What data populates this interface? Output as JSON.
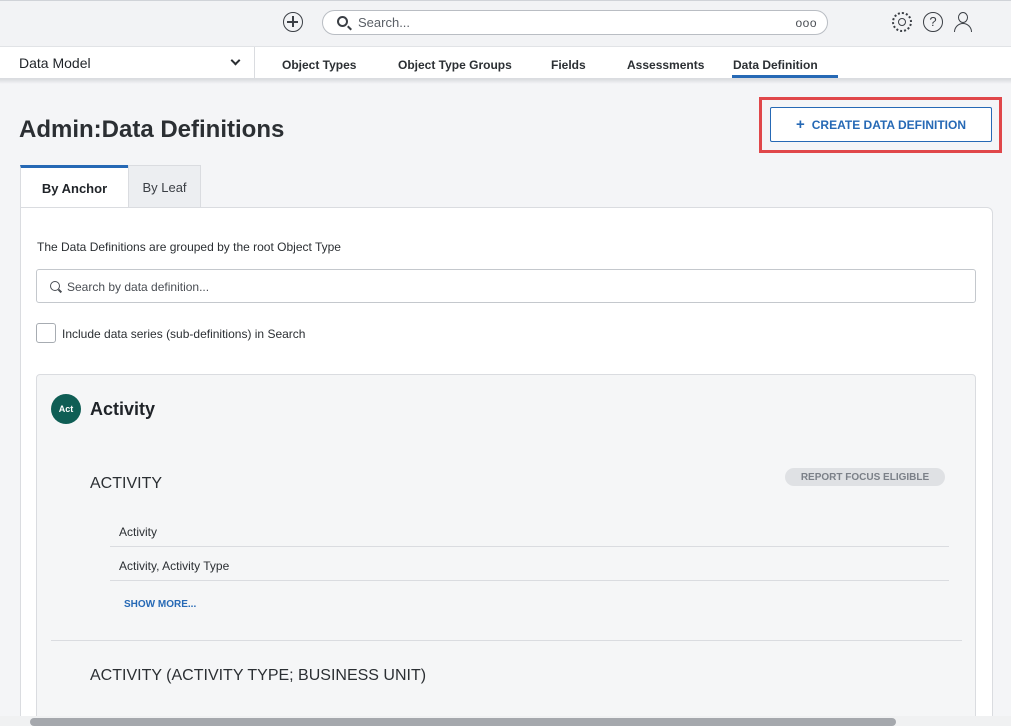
{
  "topbar": {
    "search_placeholder": "Search...",
    "search_options": "ooo",
    "help_glyph": "?",
    "icons": [
      "add-circle-icon",
      "search-icon",
      "settings-icon",
      "help-icon",
      "user-icon"
    ]
  },
  "nav": {
    "module": "Data Model",
    "tabs": [
      {
        "label": "Object Types",
        "active": false
      },
      {
        "label": "Object Type Groups",
        "active": false
      },
      {
        "label": "Fields",
        "active": false
      },
      {
        "label": "Assessments",
        "active": false
      },
      {
        "label": "Data Definition",
        "active": true
      }
    ]
  },
  "page": {
    "title": "Admin:Data Definitions",
    "create_button": "CREATE DATA DEFINITION",
    "create_plus": "+"
  },
  "tabs": [
    {
      "label": "By Anchor",
      "active": true
    },
    {
      "label": "By Leaf",
      "active": false
    }
  ],
  "panel": {
    "description": "The Data Definitions are grouped by the root Object Type",
    "search_placeholder": "Search by data definition...",
    "include_series_label": "Include data series (sub-definitions) in Search",
    "include_series_checked": false
  },
  "group": {
    "avatar": "Act",
    "name": "Activity",
    "sections": [
      {
        "title": "ACTIVITY",
        "badge": "REPORT FOCUS ELIGIBLE",
        "rows": [
          "Activity",
          "Activity, Activity Type"
        ],
        "show_more": "SHOW MORE..."
      },
      {
        "title": "ACTIVITY (ACTIVITY TYPE; BUSINESS UNIT)"
      }
    ]
  },
  "colors": {
    "accent": "#2669b5",
    "highlight": "#e0474a",
    "avatar": "#0f5e55"
  }
}
